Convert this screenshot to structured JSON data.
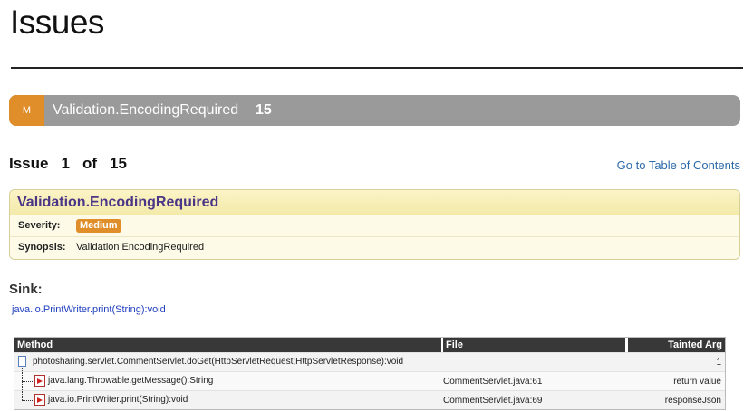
{
  "page": {
    "title": "Issues"
  },
  "category": {
    "severity_letter": "M",
    "name": "Validation.EncodingRequired",
    "count": "15"
  },
  "issue_nav": {
    "label": "Issue",
    "current": "1",
    "of": "of",
    "total": "15",
    "toc_link": "Go to Table of Contents"
  },
  "issue": {
    "title": "Validation.EncodingRequired",
    "severity_label": "Severity:",
    "severity": "Medium",
    "synopsis_label": "Synopsis:",
    "synopsis": "Validation EncodingRequired"
  },
  "sink": {
    "label": "Sink:",
    "value": "java.io.PrintWriter.print(String):void"
  },
  "trace": {
    "headers": {
      "method": "Method",
      "file": "File",
      "tainted_arg": "Tainted Arg"
    },
    "rows": [
      {
        "method": "photosharing.servlet.CommentServlet.doGet(HttpServletRequest;HttpServletResponse):void",
        "file": "",
        "arg": "1"
      },
      {
        "method": "java.lang.Throwable.getMessage():String",
        "file": "CommentServlet.java:61",
        "arg": "return value"
      },
      {
        "method": "java.io.PrintWriter.print(String):void",
        "file": "CommentServlet.java:69",
        "arg": "responseJson"
      }
    ]
  },
  "colors": {
    "severity_medium": "#e08e2a",
    "category_bar": "#9a9a9a",
    "issue_title": "#4a3587",
    "link": "#2b6aa8"
  }
}
